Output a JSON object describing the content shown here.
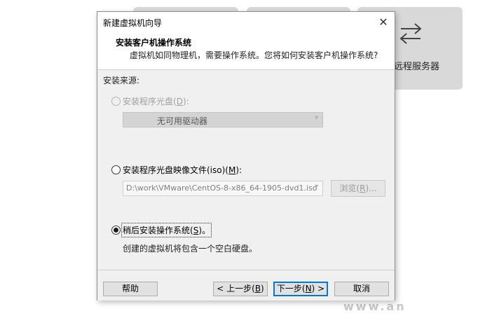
{
  "background": {
    "tile_label": "远程服务器",
    "watermark": "www.an"
  },
  "dialog": {
    "title": "新建虚拟机向导",
    "close_glyph": "✕",
    "header": {
      "title": "安装客户机操作系统",
      "subtitle": "虚拟机如同物理机，需要操作系统。您将如何安装客户机操作系统?"
    },
    "install_source_label": "安装来源:",
    "options": {
      "disc": {
        "label_pre": "安装程序光盘(",
        "key": "D",
        "label_post": "):",
        "enabled": false,
        "selected": false
      },
      "iso": {
        "label_pre": "安装程序光盘映像文件(iso)(",
        "key": "M",
        "label_post": "):",
        "enabled": true,
        "selected": false
      },
      "later": {
        "label_pre": "稍后安装操作系统(",
        "key": "S",
        "label_post": ")。",
        "enabled": true,
        "selected": true
      }
    },
    "drive_select_value": "无可用驱动器",
    "iso_path_value": "D:\\work\\VMware\\CentOS-8-x86_64-1905-dvd1.iso",
    "browse": {
      "pre": "浏览(",
      "key": "R",
      "post": ")..."
    },
    "later_description": "创建的虚拟机将包含一个空白硬盘。",
    "buttons": {
      "help": "帮助",
      "back": {
        "pre": "< 上一步(",
        "key": "B",
        "post": ")"
      },
      "next": {
        "pre": "下一步(",
        "key": "N",
        "post": ") >"
      },
      "cancel": "取消"
    }
  }
}
